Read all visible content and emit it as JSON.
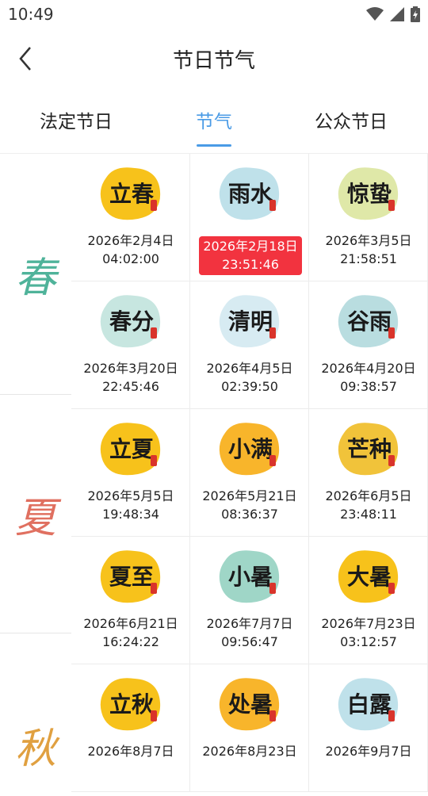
{
  "status": {
    "time": "10:49"
  },
  "header": {
    "title": "节日节气"
  },
  "tabs": [
    {
      "label": "法定节日"
    },
    {
      "label": "节气"
    },
    {
      "label": "公众节日"
    }
  ],
  "seasons": [
    {
      "label": "春",
      "color": "#4fb39a"
    },
    {
      "label": "夏",
      "color": "#e07060"
    },
    {
      "label": "秋",
      "color": "#e0a040"
    }
  ],
  "terms": [
    {
      "name": "立春",
      "date": "2026年2月4日",
      "time": "04:02:00",
      "blob": "#f7c21b"
    },
    {
      "name": "雨水",
      "date": "2026年2月18日",
      "time": "23:51:46",
      "blob": "#bfe1ea",
      "highlight": true
    },
    {
      "name": "惊蛰",
      "date": "2026年3月5日",
      "time": "21:58:51",
      "blob": "#dfe8a8"
    },
    {
      "name": "春分",
      "date": "2026年3月20日",
      "time": "22:45:46",
      "blob": "#c7e6e0"
    },
    {
      "name": "清明",
      "date": "2026年4月5日",
      "time": "02:39:50",
      "blob": "#d7ebf2"
    },
    {
      "name": "谷雨",
      "date": "2026年4月20日",
      "time": "09:38:57",
      "blob": "#b9dde0"
    },
    {
      "name": "立夏",
      "date": "2026年5月5日",
      "time": "19:48:34",
      "blob": "#f7c21b"
    },
    {
      "name": "小满",
      "date": "2026年5月21日",
      "time": "08:36:37",
      "blob": "#f8b52b"
    },
    {
      "name": "芒种",
      "date": "2026年6月5日",
      "time": "23:48:11",
      "blob": "#f1c33a"
    },
    {
      "name": "夏至",
      "date": "2026年6月21日",
      "time": "16:24:22",
      "blob": "#f7c21b"
    },
    {
      "name": "小暑",
      "date": "2026年7月7日",
      "time": "09:56:47",
      "blob": "#9fd6c7"
    },
    {
      "name": "大暑",
      "date": "2026年7月23日",
      "time": "03:12:57",
      "blob": "#f7c21b"
    },
    {
      "name": "立秋",
      "date": "2026年8月7日",
      "time": "",
      "blob": "#f7c21b"
    },
    {
      "name": "处暑",
      "date": "2026年8月23日",
      "time": "",
      "blob": "#f8b52b"
    },
    {
      "name": "白露",
      "date": "2026年9月7日",
      "time": "",
      "blob": "#bfe1ea"
    }
  ]
}
